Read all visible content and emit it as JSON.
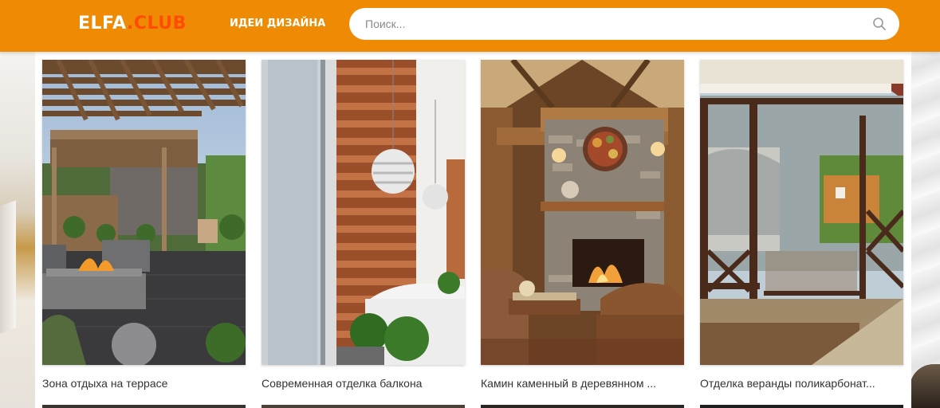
{
  "header": {
    "logo_main": "ELFA",
    "logo_accent": ".CLUB",
    "nav_link": "ИДЕИ ДИЗАЙНА",
    "search_placeholder": "Поиск...",
    "search_icon": "search-icon",
    "background_color": "#ee8a04",
    "logo_accent_color": "#ff4d00"
  },
  "gallery": {
    "cards": [
      {
        "caption": "Зона отдыха на террасе"
      },
      {
        "caption": "Современная отделка балкона"
      },
      {
        "caption": "Камин каменный в деревянном ..."
      },
      {
        "caption": "Отделка веранды поликарбонат..."
      }
    ]
  }
}
